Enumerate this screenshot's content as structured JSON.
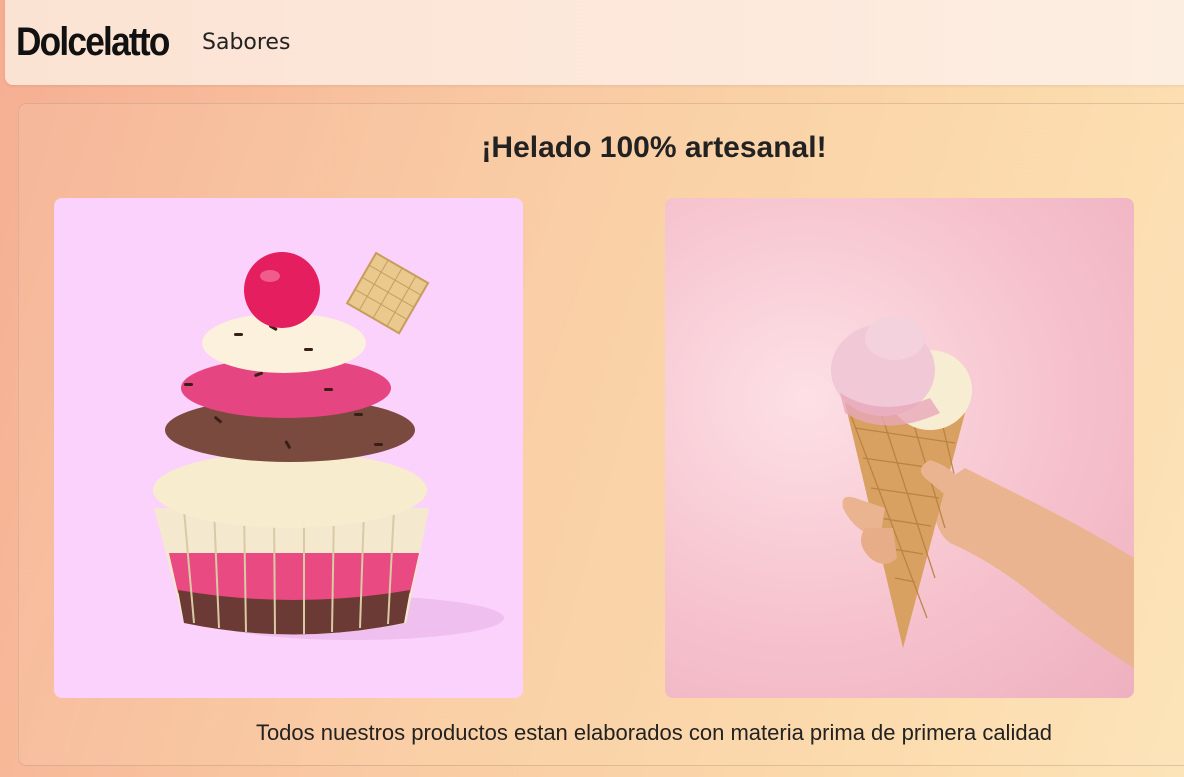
{
  "navbar": {
    "brand": "Dolcelatto",
    "links": [
      {
        "label": "Sabores"
      }
    ]
  },
  "main": {
    "heading": "¡Helado 100% artesanal!",
    "images": [
      {
        "icon": "cupcake-photo",
        "background": "#fbd2fb"
      },
      {
        "icon": "ice-cream-cone-photo",
        "background": "#f6c2cd"
      }
    ],
    "caption": "Todos nuestros productos estan elaborados con materia prima de primera calidad"
  },
  "colors": {
    "page_background": "#f9c9a3",
    "navbar_background": "#fde9dc",
    "text": "#222222"
  }
}
